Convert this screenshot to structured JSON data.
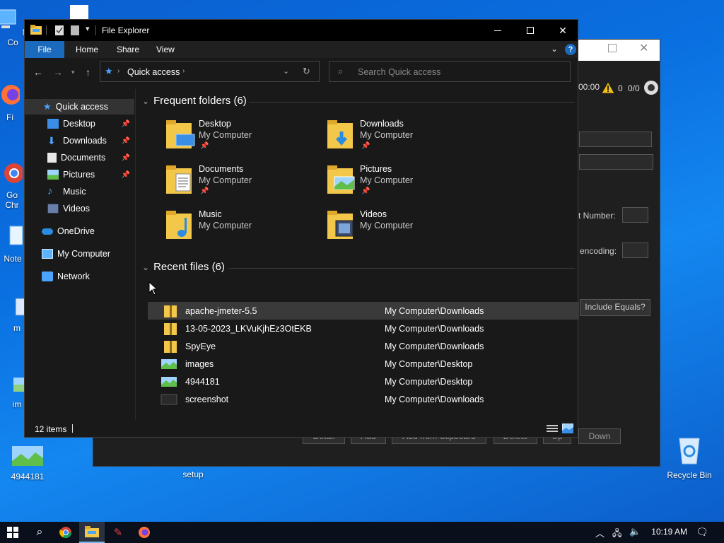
{
  "desktop": {
    "icons": [
      {
        "label": "My Co"
      },
      {
        "label": "Fi"
      },
      {
        "label": "Go\nChr"
      },
      {
        "label": "Note"
      },
      {
        "label": "m"
      },
      {
        "label": "im"
      },
      {
        "label": "4944181"
      },
      {
        "label": "setup"
      },
      {
        "label": "Recycle Bin"
      }
    ]
  },
  "bg_window": {
    "time_text": "00:00",
    "count1": "0",
    "count2": "0/0",
    "label_number": "t Number:",
    "label_encoding": "encoding:",
    "include_equals": "Include Equals?",
    "buttons": [
      "Detail",
      "Add",
      "Add from Clipboard",
      "Delete",
      "Up",
      "Down"
    ]
  },
  "explorer": {
    "title": "File Explorer",
    "ribbon_tabs": [
      "File",
      "Home",
      "Share",
      "View"
    ],
    "address": {
      "current": "Quick access"
    },
    "search": {
      "placeholder": "Search Quick access"
    },
    "sidebar": {
      "quick_access": "Quick access",
      "items": [
        {
          "label": "Desktop",
          "pinned": true
        },
        {
          "label": "Downloads",
          "pinned": true
        },
        {
          "label": "Documents",
          "pinned": true
        },
        {
          "label": "Pictures",
          "pinned": true
        },
        {
          "label": "Music",
          "pinned": false
        },
        {
          "label": "Videos",
          "pinned": false
        }
      ],
      "onedrive": "OneDrive",
      "my_computer": "My Computer",
      "network": "Network"
    },
    "frequent": {
      "heading": "Frequent folders (6)",
      "folders": [
        {
          "name": "Desktop",
          "location": "My Computer",
          "pinned": true
        },
        {
          "name": "Downloads",
          "location": "My Computer",
          "pinned": true
        },
        {
          "name": "Documents",
          "location": "My Computer",
          "pinned": true
        },
        {
          "name": "Pictures",
          "location": "My Computer",
          "pinned": true
        },
        {
          "name": "Music",
          "location": "My Computer",
          "pinned": false
        },
        {
          "name": "Videos",
          "location": "My Computer",
          "pinned": false
        }
      ]
    },
    "recent": {
      "heading": "Recent files (6)",
      "files": [
        {
          "name": "apache-jmeter-5.5",
          "location": "My Computer\\Downloads",
          "type": "zip"
        },
        {
          "name": "13-05-2023_LKVuKjhEz3OtEKB",
          "location": "My Computer\\Downloads",
          "type": "zip"
        },
        {
          "name": "SpyEye",
          "location": "My Computer\\Downloads",
          "type": "zip"
        },
        {
          "name": "images",
          "location": "My Computer\\Desktop",
          "type": "image"
        },
        {
          "name": "4944181",
          "location": "My Computer\\Desktop",
          "type": "image"
        },
        {
          "name": "screenshot",
          "location": "My Computer\\Downloads",
          "type": "image-dark"
        }
      ]
    },
    "status": {
      "items_count": "12 items"
    }
  },
  "taskbar": {
    "time": "10:19 AM"
  },
  "colors": {
    "accent": "#1a6bbd",
    "folder_yellow": "#f3c74a",
    "desktop_blue": "#0a6fe0"
  }
}
